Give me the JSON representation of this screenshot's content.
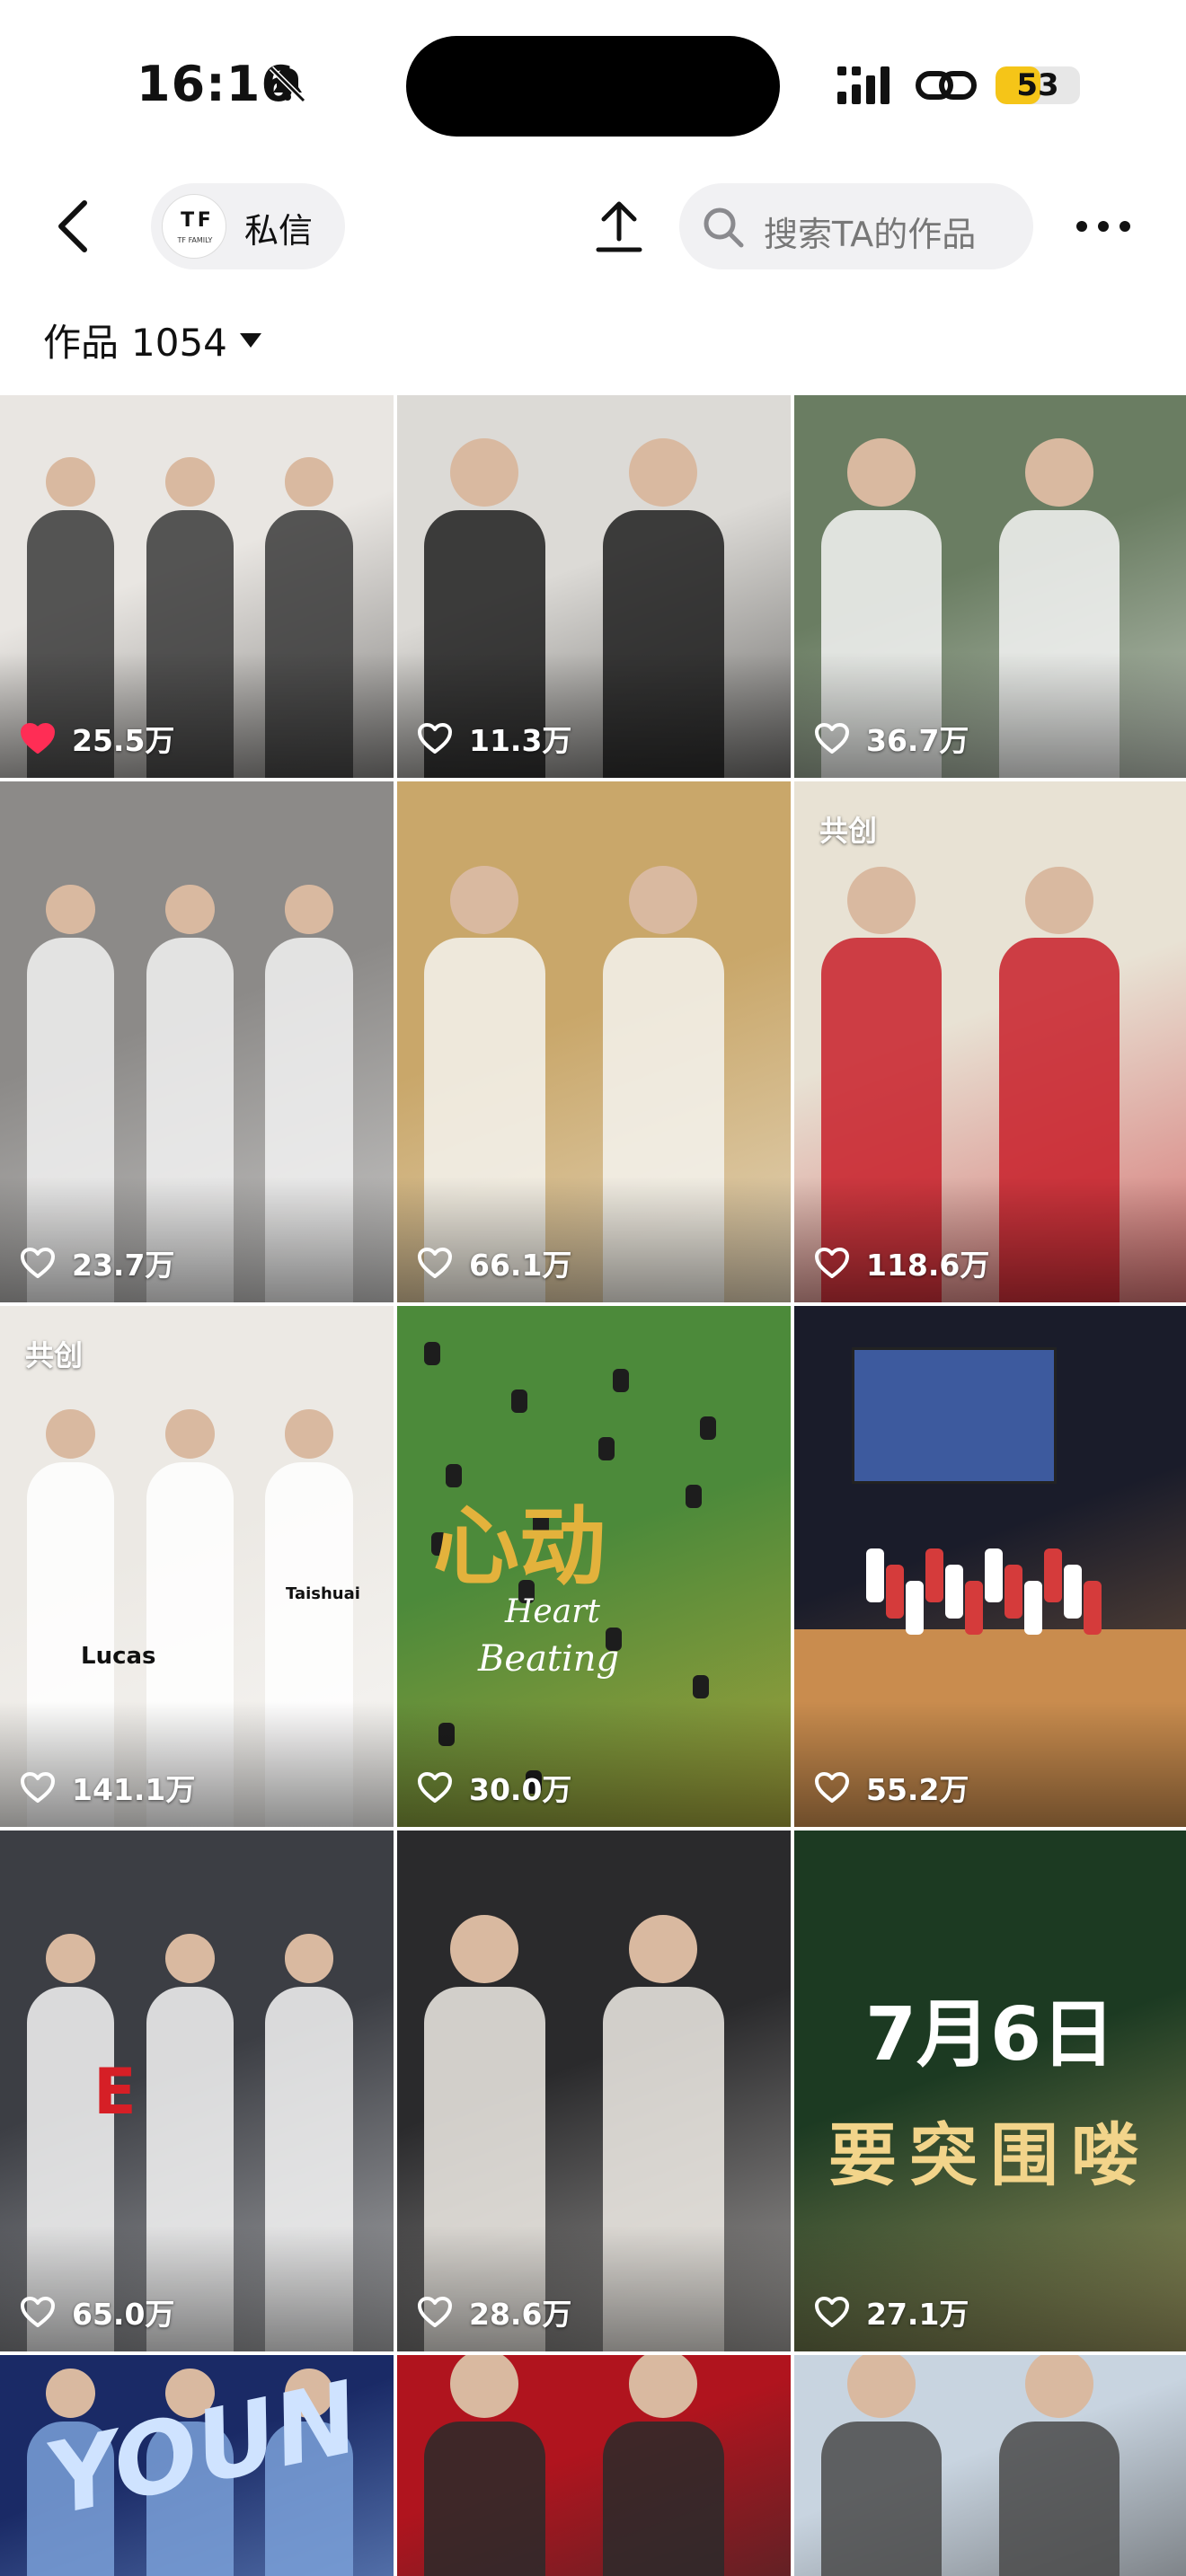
{
  "status_bar": {
    "time": "16:16",
    "battery": "53",
    "battery_level_percent": 53
  },
  "nav": {
    "dm_label": "私信",
    "avatar_mark": "T F",
    "avatar_sub": "TF FAMILY",
    "search_placeholder": "搜索TA的作品"
  },
  "works": {
    "label": "作品",
    "count": "1054"
  },
  "grid": {
    "items": [
      {
        "likes": "25.5万",
        "liked": true,
        "badge": "",
        "icons": "heart-filled-icon",
        "palette": [
          "#e9e6e2",
          "#3a3a3a"
        ]
      },
      {
        "likes": "11.3万",
        "liked": false,
        "badge": "",
        "icons": "heart-outline-icon",
        "palette": [
          "#dcdad6",
          "#1e1e1e"
        ]
      },
      {
        "likes": "36.7万",
        "liked": false,
        "badge": "",
        "icons": "heart-outline-icon",
        "palette": [
          "#6a7d62",
          "#f4f4f4"
        ]
      },
      {
        "likes": "23.7万",
        "liked": false,
        "badge": "",
        "icons": "heart-outline-icon",
        "palette": [
          "#8c8a88",
          "#f2f2f2"
        ]
      },
      {
        "likes": "66.1万",
        "liked": false,
        "badge": "",
        "icons": "heart-outline-icon",
        "palette": [
          "#c9a76a",
          "#f5f3ef"
        ]
      },
      {
        "likes": "118.6万",
        "liked": false,
        "badge": "共创",
        "icons": "heart-outline-icon",
        "palette": [
          "#e8e2d4",
          "#c8202a"
        ]
      },
      {
        "likes": "141.1万",
        "liked": false,
        "badge": "共创",
        "icons": "heart-outline-icon",
        "palette": [
          "#ece9e4",
          "#ffffff"
        ]
      },
      {
        "likes": "30.0万",
        "liked": false,
        "badge": "",
        "icons": "heart-outline-icon",
        "palette": [
          "#4c8a3a",
          "#e3b23c"
        ]
      },
      {
        "likes": "55.2万",
        "liked": false,
        "badge": "",
        "icons": "heart-outline-icon",
        "palette": [
          "#1a1c2a",
          "#c98c4e"
        ]
      },
      {
        "likes": "65.0万",
        "liked": false,
        "badge": "",
        "icons": "heart-outline-icon",
        "palette": [
          "#3c3e44",
          "#f6f6f6"
        ]
      },
      {
        "likes": "28.6万",
        "liked": false,
        "badge": "",
        "icons": "heart-outline-icon",
        "palette": [
          "#2a2a2c",
          "#f0ece6"
        ]
      },
      {
        "likes": "27.1万",
        "liked": false,
        "badge": "",
        "icons": "heart-outline-icon",
        "palette": [
          "#1c3a22",
          "#f2d48a"
        ]
      },
      {
        "likes": "",
        "liked": false,
        "badge": "",
        "icons": "",
        "palette": [
          "#1a2a66",
          "#7aa0d8"
        ]
      },
      {
        "likes": "",
        "liked": false,
        "badge": "",
        "icons": "",
        "palette": [
          "#b0141e",
          "#2a2a2a"
        ]
      },
      {
        "likes": "",
        "liked": false,
        "badge": "",
        "icons": "",
        "palette": [
          "#c8d4e0",
          "#4a4a4a"
        ]
      }
    ],
    "tile_texts": {
      "t8_title": "心动",
      "t8_sub1": "Heart",
      "t8_sub2": "Beating",
      "t12_line1": "7月6日",
      "t12_line2": "要突围喽",
      "t10_shirt": "E",
      "t7_shirt1": "Lucas",
      "t7_shirt2": "Taishuai",
      "t13_sign": "YOUN"
    }
  },
  "colors": {
    "liked_heart": "#ff2d55",
    "search_bg": "#f1f1f3",
    "battery_yellow": "#f5c518"
  }
}
